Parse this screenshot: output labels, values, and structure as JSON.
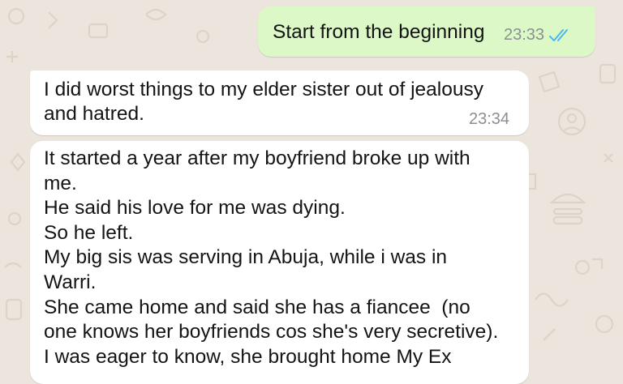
{
  "messages": [
    {
      "direction": "outgoing",
      "text": "Start from the beginning",
      "time": "23:33",
      "status_icon": "double-check-read-icon",
      "status_color": "#4fb6ec"
    },
    {
      "direction": "incoming",
      "text": "I did worst things to my elder sister out of jealousy\nand hatred.",
      "time": "23:34"
    },
    {
      "direction": "incoming",
      "text": "It started a year after my boyfriend broke up with\nme.\nHe said his love for me was dying.\nSo he left.\nMy big sis was serving in Abuja, while i was in\nWarri.\nShe came home and said she has a fiancee  (no\none knows her boyfriends cos she's very secretive).\nI was eager to know, she brought home My Ex"
    }
  ],
  "colors": {
    "chat_background": "#ece5dd",
    "outgoing_bubble": "#dcf8c6",
    "incoming_bubble": "#ffffff"
  }
}
